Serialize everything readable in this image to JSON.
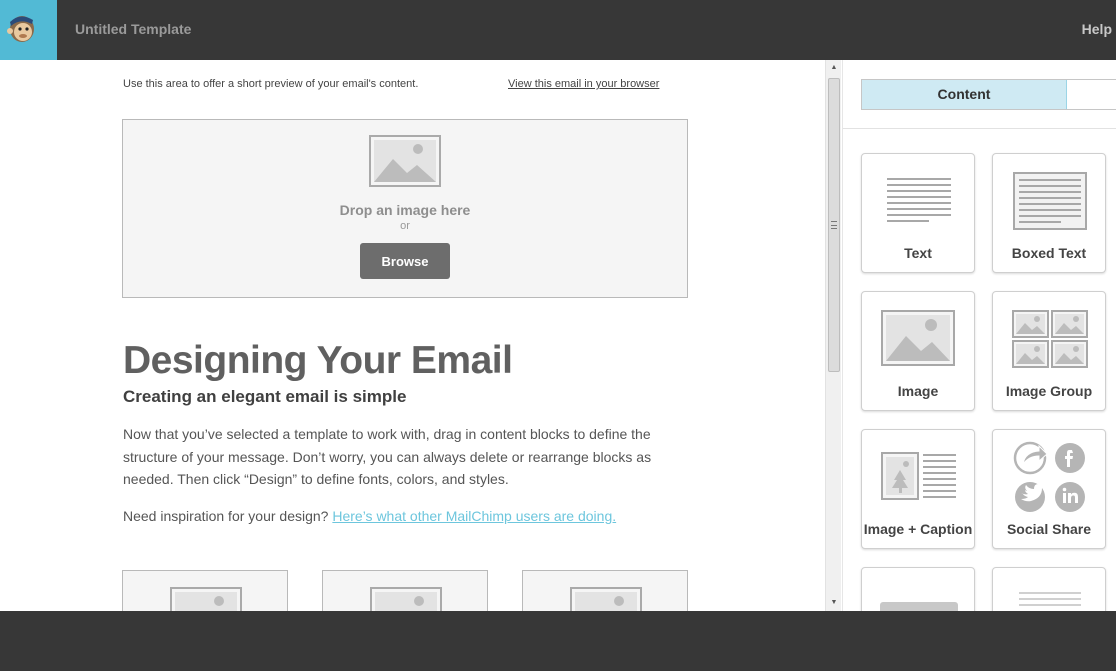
{
  "app": {
    "title": "Untitled Template",
    "help": "Help"
  },
  "email": {
    "preheader": "Use this area to offer a short preview of your email's content.",
    "view_in_browser": "View this email in your browser",
    "dropzone": {
      "text": "Drop an image here",
      "or": "or",
      "browse": "Browse"
    },
    "heading": "Designing Your Email",
    "subheading": "Creating an elegant email is simple",
    "body": "Now that you’ve selected a template to work with, drag in content blocks to define the structure of your message. Don’t worry, you can always delete or rearrange blocks as needed. Then click “Design” to define fonts, colors, and styles.",
    "inspiration_prefix": "Need inspiration for your design?",
    "inspiration_link": "Here’s what other MailChimp users are doing."
  },
  "panel": {
    "tabs": [
      {
        "label": "Content",
        "active": true
      }
    ],
    "blocks": [
      {
        "label": "Text",
        "icon": "text-block-icon"
      },
      {
        "label": "Boxed Text",
        "icon": "boxed-text-block-icon"
      },
      {
        "label": "Image",
        "icon": "image-block-icon"
      },
      {
        "label": "Image Group",
        "icon": "image-group-block-icon"
      },
      {
        "label": "Image + Caption",
        "icon": "image-caption-block-icon"
      },
      {
        "label": "Social Share",
        "icon": "social-share-block-icon"
      }
    ]
  },
  "colors": {
    "topbar": "#373737",
    "accent": "#52bad5",
    "link": "#6dc6dd",
    "tab_active": "#cfeaf3"
  }
}
